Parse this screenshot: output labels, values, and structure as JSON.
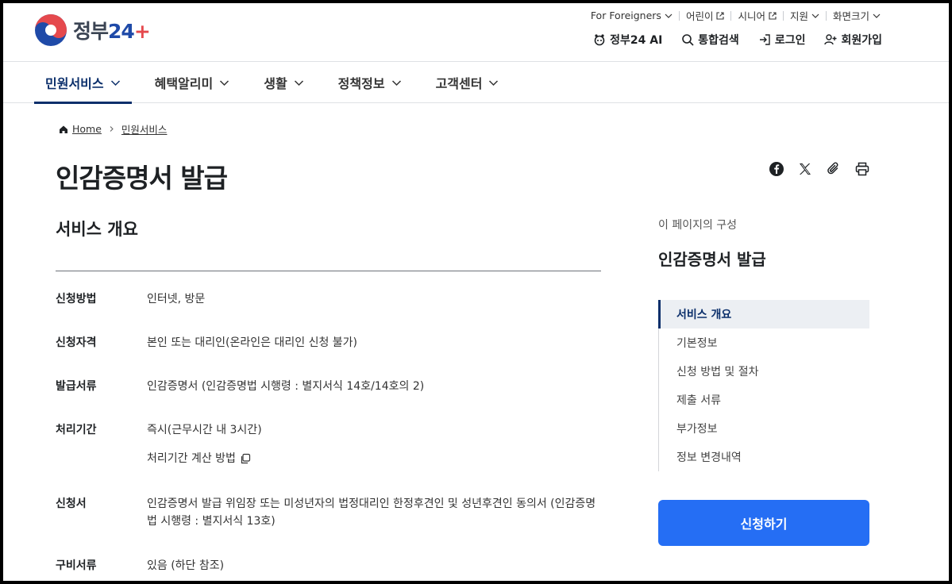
{
  "header": {
    "logo_text": "정부",
    "logo_num": "24",
    "logo_plus": "+",
    "util_links": [
      {
        "label": "For Foreigners",
        "icon": "chevron-down-icon"
      },
      {
        "label": "어린이",
        "icon": "external-link-icon"
      },
      {
        "label": "시니어",
        "icon": "external-link-icon"
      },
      {
        "label": "지원",
        "icon": "chevron-down-icon"
      },
      {
        "label": "화면크기",
        "icon": "chevron-down-icon"
      }
    ],
    "actions": [
      {
        "label": "정부24 AI",
        "icon": "ai-icon"
      },
      {
        "label": "통합검색",
        "icon": "search-icon"
      },
      {
        "label": "로그인",
        "icon": "login-icon"
      },
      {
        "label": "회원가입",
        "icon": "user-add-icon"
      }
    ]
  },
  "gnb": {
    "items": [
      "민원서비스",
      "혜택알리미",
      "생활",
      "정책정보",
      "고객센터"
    ],
    "active_index": 0
  },
  "breadcrumb": {
    "home": "Home",
    "current": "민원서비스"
  },
  "page": {
    "title": "인감증명서 발급"
  },
  "share_icons": [
    "facebook-icon",
    "x-icon",
    "link-icon",
    "print-icon"
  ],
  "overview": {
    "title": "서비스 개요",
    "rows": [
      {
        "label": "신청방법",
        "value": "인터넷, 방문"
      },
      {
        "label": "신청자격",
        "value": "본인 또는 대리인(온라인은 대리인 신청 불가)"
      },
      {
        "label": "발급서류",
        "value": "인감증명서 (인감증명법 시행령 : 별지서식 14호/14호의 2)"
      },
      {
        "label": "처리기간",
        "value": "즉시(근무시간 내 3시간)",
        "sub": "처리기간 계산 방법"
      },
      {
        "label": "신청서",
        "value": "인감증명서 발급 위임장 또는 미성년자의 법정대리인 한정후견인 및 성년후견인 동의서 (인감증명법 시행령 : 별지서식 13호)"
      },
      {
        "label": "구비서류",
        "value": "있음 (하단 참조)"
      }
    ]
  },
  "toc": {
    "caption": "이 페이지의 구성",
    "title": "인감증명서 발급",
    "items": [
      "서비스 개요",
      "기본정보",
      "신청 방법 및 절차",
      "제출 서류",
      "부가정보",
      "정보 변경내역"
    ],
    "active_index": 0
  },
  "apply_button": "신청하기",
  "colors": {
    "primary": "#256ef4",
    "navy": "#0b2f6b",
    "logo_red": "#e5494d",
    "logo_blue": "#1f4aa8"
  }
}
